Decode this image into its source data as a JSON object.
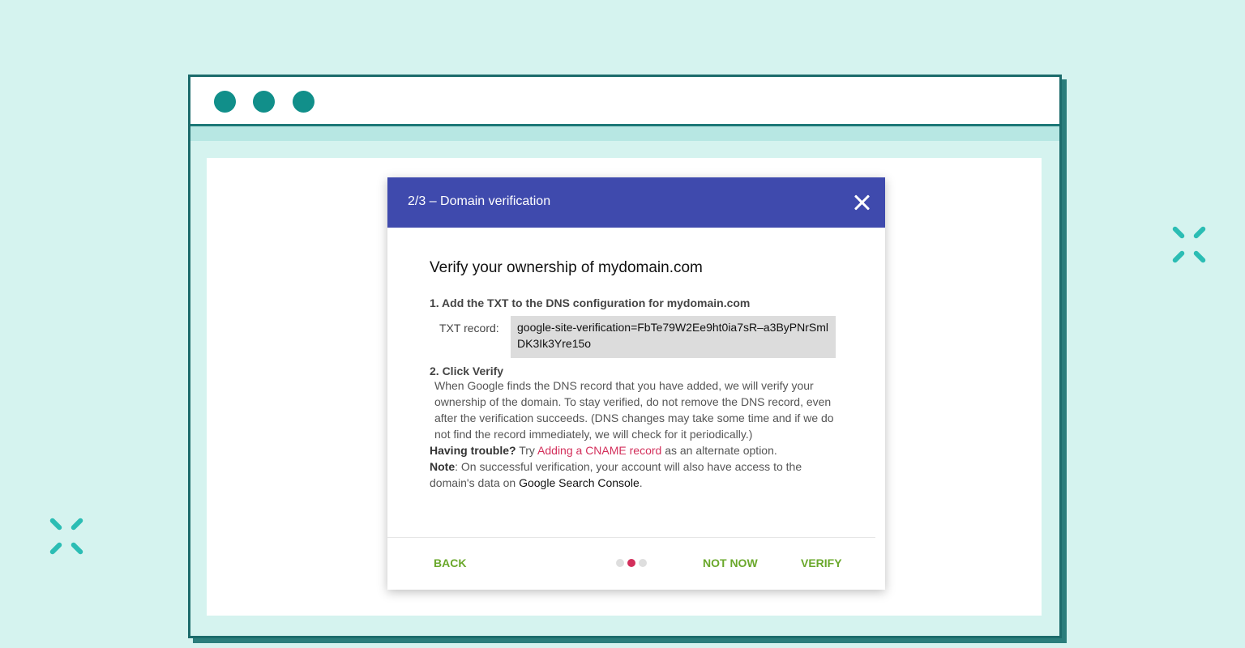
{
  "colors": {
    "background": "#d5f3ef",
    "window_border": "#1c6b6b",
    "traffic_dots": "#118f8a",
    "dialog_header": "#3f4aad",
    "link": "#d32f5b",
    "action_button": "#6aa82b",
    "sparkle": "#2bbdb4"
  },
  "dialog": {
    "title": "2/3 – Domain verification",
    "close_icon": "close-icon",
    "heading": "Verify your ownership of mydomain.com",
    "step1_label": "1. Add the TXT to the DNS configuration for mydomain.com",
    "txt_label": "TXT record:",
    "txt_value": "google-site-verification=FbTe79W2Ee9ht0ia7sR–a3ByPNrSmlDK3Ik3Yre15o",
    "step2_label": "2. Click Verify",
    "step2_text": "When Google finds the DNS record that you have added, we will verify your ownership of the domain. To stay verified, do not remove the DNS record, even after the verification succeeds. (DNS changes may take some time and if we do not find the record immediately, we will check for it periodically.)",
    "trouble_label": "Having trouble?",
    "trouble_pre": "Try",
    "trouble_link": "Adding a CNAME record",
    "trouble_post": "as an alternate option.",
    "note_label": "Note",
    "note_text": ": On successful verification, your account will also have access to the domain's data on",
    "note_link": "Google Search Console",
    "note_end": ".",
    "footer": {
      "back": "BACK",
      "not_now": "NOT NOW",
      "verify": "VERIFY",
      "steps_total": 3,
      "current_step": 2
    }
  }
}
